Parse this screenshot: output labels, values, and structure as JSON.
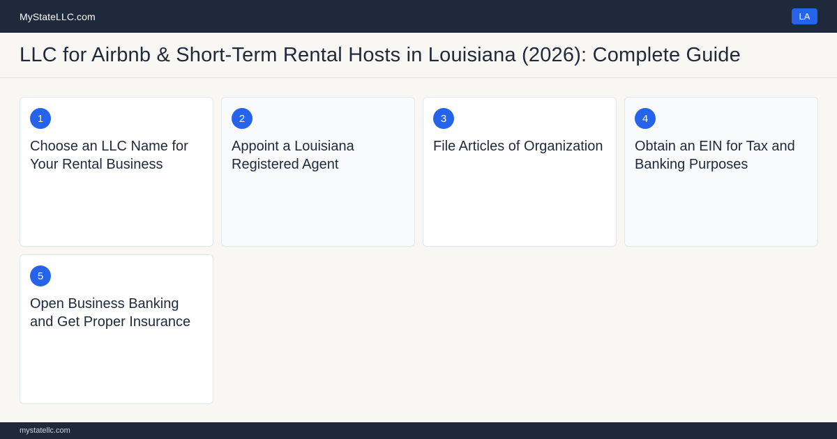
{
  "header": {
    "brand": "MyStateLLC.com",
    "state_badge": "LA"
  },
  "page": {
    "title": "LLC for Airbnb & Short-Term Rental Hosts in Louisiana (2026): Complete Guide"
  },
  "steps": [
    {
      "number": "1",
      "title": "Choose an LLC Name for Your Rental Business"
    },
    {
      "number": "2",
      "title": "Appoint a Louisiana Registered Agent"
    },
    {
      "number": "3",
      "title": "File Articles of Organization"
    },
    {
      "number": "4",
      "title": "Obtain an EIN for Tax and Banking Purposes"
    },
    {
      "number": "5",
      "title": "Open Business Banking and Get Proper Insurance"
    }
  ],
  "footer": {
    "domain": "mystatellc.com"
  },
  "colors": {
    "header_bg": "#1e293b",
    "accent": "#2563eb",
    "page_bg": "#f9f7f3"
  }
}
